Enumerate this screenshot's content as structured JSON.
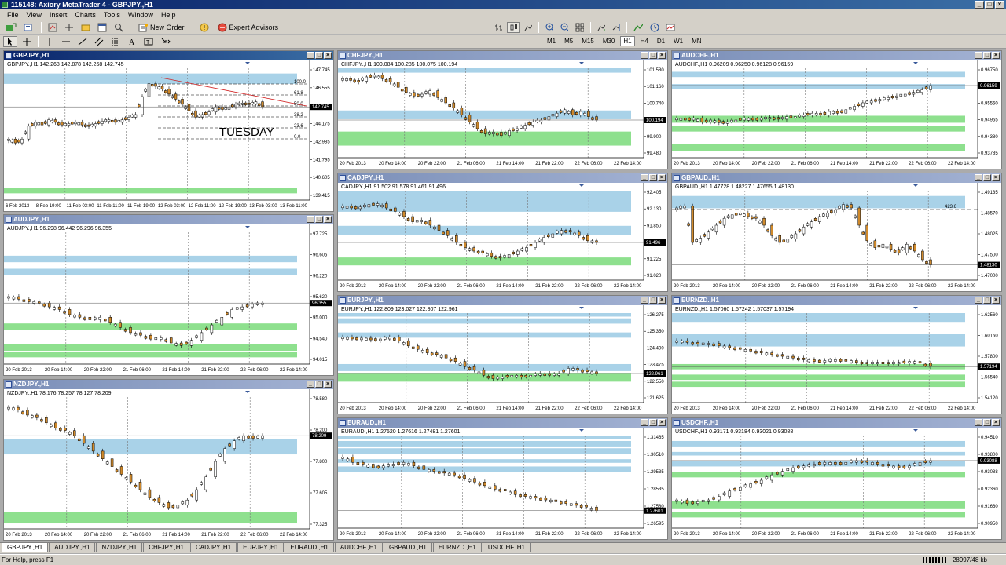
{
  "window": {
    "title": "115148: Axiory MetaTrader 4 - GBPJPY.,H1",
    "min": "_",
    "max": "□",
    "close": "×"
  },
  "menu": [
    "File",
    "View",
    "Insert",
    "Charts",
    "Tools",
    "Window",
    "Help"
  ],
  "toolbar": {
    "new_order": "New Order",
    "expert_advisors": "Expert Advisors"
  },
  "timeframes": [
    "M1",
    "M5",
    "M15",
    "M30",
    "H1",
    "H4",
    "D1",
    "W1",
    "MN"
  ],
  "active_timeframe": "H1",
  "colors": {
    "bull": "#ffffff",
    "bear": "#d08a2c",
    "supply_zone": "#a9d2e8",
    "demand_zone": "#8ee08e",
    "grid": "#5a5a5a"
  },
  "charts": [
    {
      "id": "gbpjpy",
      "title": "GBPJPY.,H1",
      "active": true,
      "info": "GBPJPY.,H1  142.268 142.878 142.268 142.745",
      "prices": [
        "147.745",
        "146.555",
        "145.365",
        "144.175",
        "142.985",
        "141.795",
        "140.605",
        "139.415"
      ],
      "current": "142.745",
      "times": [
        "6 Feb 2013",
        "8 Feb 19:00",
        "11 Feb 03:00",
        "11 Feb 11:00",
        "11 Feb 19:00",
        "12 Feb 03:00",
        "12 Feb 11:00",
        "12 Feb 19:00",
        "13 Feb 03:00",
        "13 Feb 11:00"
      ],
      "annotation": "TUESDAY",
      "fibo": [
        "100.0",
        "61.8",
        "50.0",
        "38.2",
        "23.6",
        "0.0"
      ]
    },
    {
      "id": "chfjpy",
      "title": "CHFJPY.,H1",
      "info": "CHFJPY.,H1  100.084 100.285 100.075 100.194",
      "prices": [
        "101.580",
        "101.160",
        "100.740",
        "100.320",
        "99.900",
        "99.480"
      ],
      "current": "100.194",
      "times": [
        "20 Feb 2013",
        "20 Feb 14:00",
        "20 Feb 22:00",
        "21 Feb 06:00",
        "21 Feb 14:00",
        "21 Feb 22:00",
        "22 Feb 06:00",
        "22 Feb 14:00"
      ]
    },
    {
      "id": "audchf",
      "title": "AUDCHF.,H1",
      "info": "AUDCHF.,H1  0.96209 0.96250 0.96128 0.96159",
      "prices": [
        "0.96750",
        "0.96155",
        "0.95560",
        "0.94965",
        "0.94380",
        "0.93785"
      ],
      "current": "0.96159",
      "times": [
        "20 Feb 2013",
        "20 Feb 14:00",
        "20 Feb 22:00",
        "21 Feb 06:00",
        "21 Feb 14:00",
        "21 Feb 22:00",
        "22 Feb 06:00",
        "22 Feb 14:00"
      ]
    },
    {
      "id": "audjpy",
      "title": "AUDJPY.,H1",
      "info": "AUDJPY.,H1  96.298 96.442 96.296 96.355",
      "prices": [
        "97.725",
        "96.605",
        "96.220",
        "95.620",
        "95.000",
        "94.540",
        "94.015"
      ],
      "current": "96.355",
      "times": [
        "20 Feb 2013",
        "20 Feb 14:00",
        "20 Feb 22:00",
        "21 Feb 06:00",
        "21 Feb 14:00",
        "21 Feb 22:00",
        "22 Feb 06:00",
        "22 Feb 14:00"
      ]
    },
    {
      "id": "cadjpy",
      "title": "CADJPY.,H1",
      "info": "CADJPY.,H1  91.502 91.578 91.461 91.496",
      "prices": [
        "92.405",
        "92.130",
        "91.850",
        "91.520",
        "91.225",
        "91.020"
      ],
      "current": "91.496",
      "times": [
        "20 Feb 2013",
        "20 Feb 14:00",
        "20 Feb 22:00",
        "21 Feb 06:00",
        "21 Feb 14:00",
        "21 Feb 22:00",
        "22 Feb 06:00",
        "22 Feb 14:00"
      ]
    },
    {
      "id": "gbpaud",
      "title": "GBPAUD.,H1",
      "info": "GBPAUD.,H1  1.47728 1.48227 1.47655 1.48130",
      "prices": [
        "1.49135",
        "1.48570",
        "1.48025",
        "1.47500",
        "1.47000"
      ],
      "current": "1.48130",
      "times": [
        "20 Feb 2013",
        "20 Feb 14:00",
        "20 Feb 22:00",
        "21 Feb 06:00",
        "21 Feb 14:00",
        "21 Feb 22:00",
        "22 Feb 06:00",
        "22 Feb 14:00"
      ],
      "marker": "423.6"
    },
    {
      "id": "nzdjpy",
      "title": "NZDJPY.,H1",
      "info": "NZDJPY.,H1  78.176 78.257 78.127 78.209",
      "prices": [
        "78.580",
        "78.200",
        "77.800",
        "77.605",
        "77.325"
      ],
      "current": "78.209",
      "times": [
        "20 Feb 2013",
        "20 Feb 14:00",
        "20 Feb 22:00",
        "21 Feb 06:00",
        "21 Feb 14:00",
        "21 Feb 22:00",
        "22 Feb 06:00",
        "22 Feb 14:00"
      ]
    },
    {
      "id": "eurjpy",
      "title": "EURJPY.,H1",
      "info": "EURJPY.,H1  122.809 123.027 122.807 122.961",
      "prices": [
        "126.275",
        "125.350",
        "124.400",
        "123.475",
        "122.550",
        "121.625"
      ],
      "current": "122.961",
      "times": [
        "20 Feb 2013",
        "20 Feb 14:00",
        "20 Feb 22:00",
        "21 Feb 06:00",
        "21 Feb 14:00",
        "21 Feb 22:00",
        "22 Feb 06:00",
        "22 Feb 14:00"
      ]
    },
    {
      "id": "eurnzd",
      "title": "EURNZD.,H1",
      "info": "EURNZD.,H1  1.57060 1.57242 1.57037 1.57194",
      "prices": [
        "1.62560",
        "1.60160",
        "1.57800",
        "1.56540",
        "1.54120"
      ],
      "current": "1.57194",
      "times": [
        "20 Feb 2013",
        "20 Feb 14:00",
        "20 Feb 22:00",
        "21 Feb 06:00",
        "21 Feb 14:00",
        "21 Feb 22:00",
        "22 Feb 06:00",
        "22 Feb 14:00"
      ]
    },
    {
      "id": "euraud",
      "title": "EURAUD.,H1",
      "info": "EURAUD.,H1  1.27520 1.27616 1.27481 1.27601",
      "prices": [
        "1.31465",
        "1.30510",
        "1.29535",
        "1.28535",
        "1.27580",
        "1.26595"
      ],
      "current": "1.27601",
      "times": [
        "20 Feb 2013",
        "20 Feb 14:00",
        "20 Feb 22:00",
        "21 Feb 06:00",
        "21 Feb 14:00",
        "21 Feb 22:00",
        "22 Feb 06:00",
        "22 Feb 14:00"
      ]
    },
    {
      "id": "usdchf",
      "title": "USDCHF.,H1",
      "info": "USDCHF.,H1  0.93171 0.93184 0.93021 0.93088",
      "prices": [
        "0.94510",
        "0.93800",
        "0.93088",
        "0.92360",
        "0.91660",
        "0.90950"
      ],
      "current": "0.93088",
      "times": [
        "20 Feb 2013",
        "20 Feb 14:00",
        "20 Feb 22:00",
        "21 Feb 06:00",
        "21 Feb 14:00",
        "21 Feb 22:00",
        "22 Feb 06:00",
        "22 Feb 14:00"
      ]
    }
  ],
  "tabs": [
    "GBPJPY.,H1",
    "AUDJPY.,H1",
    "NZDJPY.,H1",
    "CHFJPY.,H1",
    "CADJPY.,H1",
    "EURJPY.,H1",
    "EURAUD.,H1",
    "AUDCHF.,H1",
    "GBPAUD.,H1",
    "EURNZD.,H1",
    "USDCHF.,H1"
  ],
  "status": {
    "help": "For Help, press F1",
    "traffic": "28997/48 kb"
  }
}
